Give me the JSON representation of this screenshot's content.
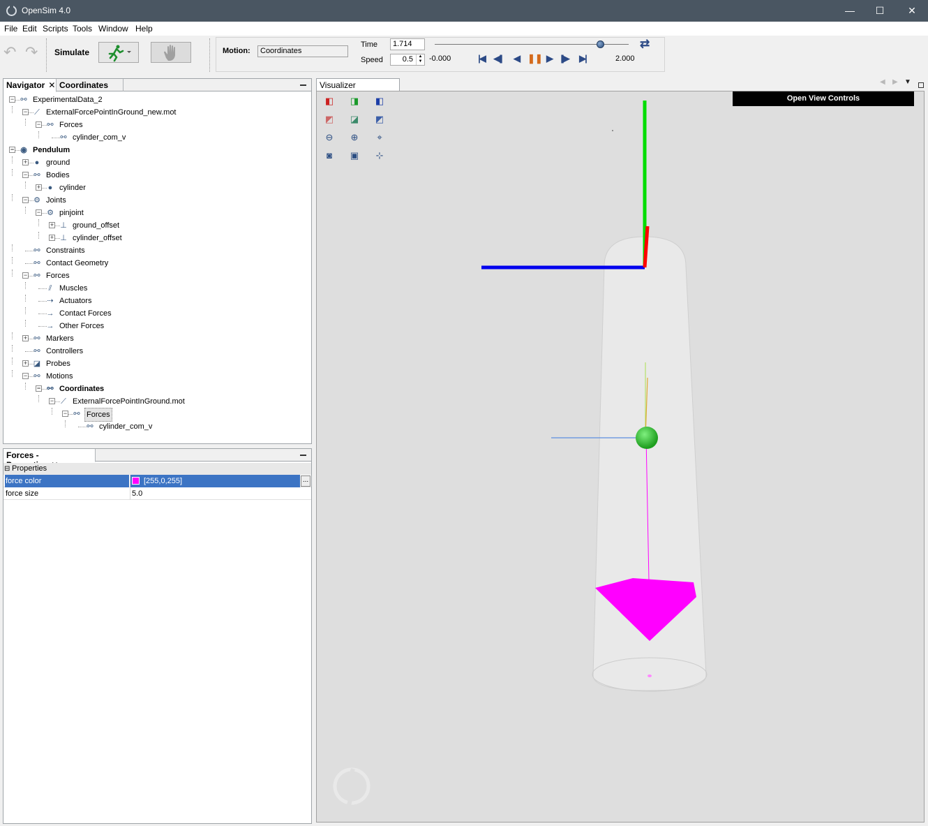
{
  "window": {
    "title": "OpenSim 4.0",
    "minimize": "—",
    "maximize": "☐",
    "close": "✕"
  },
  "menu": [
    "File",
    "Edit",
    "Scripts",
    "Tools",
    "Window",
    "Help"
  ],
  "toolbar": {
    "simulate_label": "Simulate",
    "motion_label": "Motion:",
    "motion_value": "Coordinates",
    "time_label": "Time",
    "time_value": "1.714",
    "speed_label": "Speed",
    "speed_value": "0.5",
    "range_start": "-0.000",
    "range_end": "2.000",
    "time_fraction": 0.857
  },
  "navigator": {
    "tabs": [
      {
        "label": "Navigator",
        "close": "✕"
      },
      {
        "label": "Coordinates"
      }
    ],
    "tree": [
      {
        "label": "ExperimentalData_2"
      },
      {
        "label": "ExternalForcePointInGround_new.mot"
      },
      {
        "label": "Forces"
      },
      {
        "label": "cylinder_com_v"
      },
      {
        "label": "Pendulum"
      },
      {
        "label": "ground"
      },
      {
        "label": "Bodies"
      },
      {
        "label": "cylinder"
      },
      {
        "label": "Joints"
      },
      {
        "label": "pinjoint"
      },
      {
        "label": "ground_offset"
      },
      {
        "label": "cylinder_offset"
      },
      {
        "label": "Constraints"
      },
      {
        "label": "Contact Geometry"
      },
      {
        "label": "Forces"
      },
      {
        "label": "Muscles"
      },
      {
        "label": "Actuators"
      },
      {
        "label": "Contact Forces"
      },
      {
        "label": "Other Forces"
      },
      {
        "label": "Markers"
      },
      {
        "label": "Controllers"
      },
      {
        "label": "Probes"
      },
      {
        "label": "Motions"
      },
      {
        "label": "Coordinates"
      },
      {
        "label": "ExternalForcePointInGround.mot"
      },
      {
        "label": "Forces"
      },
      {
        "label": "cylinder_com_v"
      }
    ]
  },
  "properties": {
    "tab_label": "Forces - Properties",
    "tab_close": "✕",
    "section": "Properties",
    "section_toggle": "⊟",
    "rows": [
      {
        "name": "force color",
        "value": "[255,0,255]",
        "swatch": "#ff00ff",
        "button": "..."
      },
      {
        "name": "force size",
        "value": "5.0"
      }
    ]
  },
  "visualizer": {
    "tab_label": "Visualizer Window",
    "tab_close": "✕",
    "open_view_controls": "Open View Controls"
  },
  "colors": {
    "titlebar": "#4a5662",
    "selection": "#3c74c4",
    "force_color": "#ff00ff",
    "axis_x": "#ff0000",
    "axis_y": "#00dd00",
    "axis_z": "#0000ee",
    "body_marker": "#33cc33"
  }
}
